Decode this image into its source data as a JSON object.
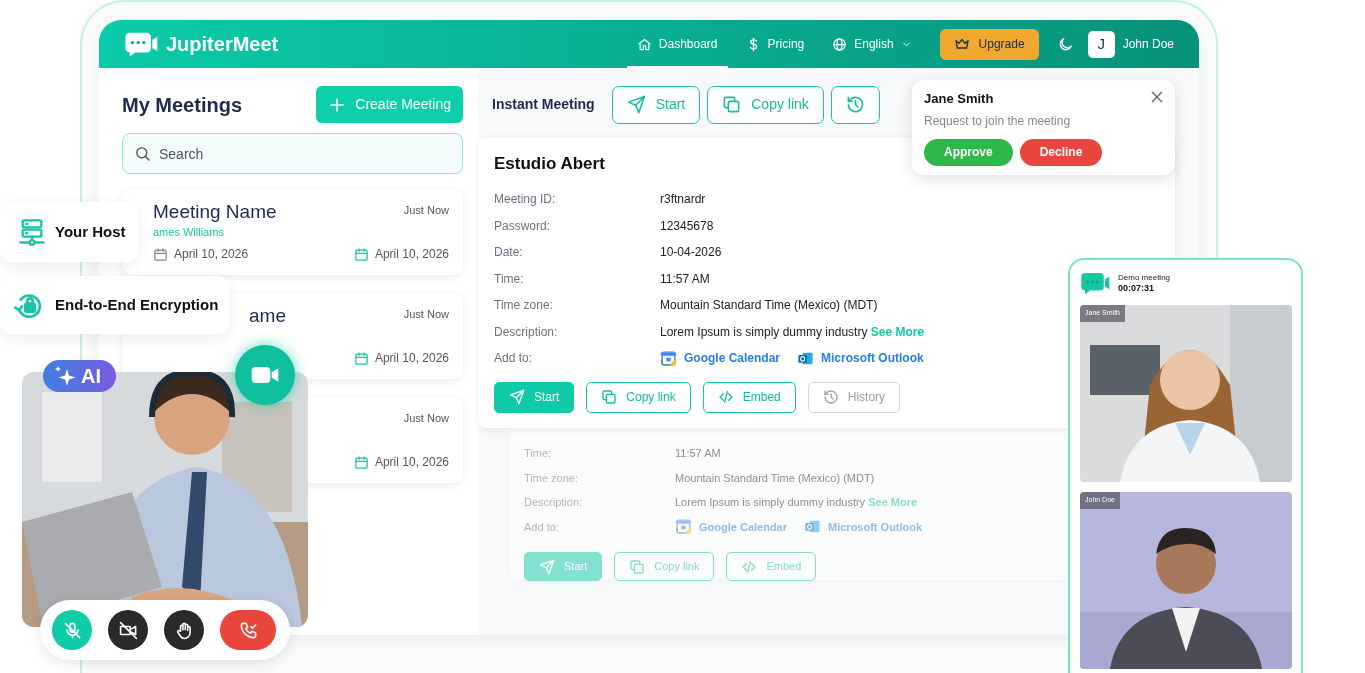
{
  "nav": {
    "brand": "JupiterMeet",
    "items": [
      {
        "label": "Dashboard",
        "selected": true,
        "dropdown": false
      },
      {
        "label": "Pricing",
        "selected": false,
        "dropdown": false
      },
      {
        "label": "English",
        "selected": false,
        "dropdown": true
      }
    ],
    "upgrade": "Upgrade",
    "user": {
      "initial": "J",
      "name": "John Doe"
    }
  },
  "meetings": {
    "title": "My Meetings",
    "create": "Create Meeting",
    "search": {
      "placeholder": "Search"
    },
    "items": [
      {
        "title": "Meeting Name",
        "time": "Just Now",
        "host": "ames Williams",
        "start_date": "April 10, 2026",
        "end_date": "April 10, 2026"
      },
      {
        "title": "ame",
        "time": "Just Now",
        "end_date": "April 10, 2026"
      },
      {
        "time": "Just Now",
        "end_date": "April 10, 2026"
      }
    ]
  },
  "instant": {
    "label": "Instant Meeting",
    "buttons": [
      {
        "kind": "start",
        "label": "Start"
      },
      {
        "kind": "copy",
        "label": "Copy link"
      },
      {
        "kind": "history"
      }
    ]
  },
  "detail": {
    "title": "Estudio Abert",
    "rows": [
      {
        "kind": "text",
        "label": "Meeting ID:",
        "value": "r3ftnardr"
      },
      {
        "kind": "text",
        "label": "Password:",
        "value": "12345678"
      },
      {
        "kind": "text",
        "label": "Date:",
        "value": "10-04-2026"
      },
      {
        "kind": "text",
        "label": "Time:",
        "value": "11:57 AM"
      },
      {
        "kind": "text",
        "label": "Time zone:",
        "value": "Mountain Standard Time (Mexico) (MDT)"
      },
      {
        "kind": "text",
        "label": "Description:",
        "value": "Lorem Ipsum is simply dummy industry",
        "link": "See More"
      },
      {
        "kind": "calendars",
        "label": "Add to:",
        "calendars": [
          {
            "kind": "google",
            "label": "Google Calendar"
          },
          {
            "kind": "outlook",
            "label": "Microsoft Outlook"
          }
        ]
      }
    ],
    "buttons": [
      {
        "label": "Start",
        "kind": "primary",
        "disabled": false
      },
      {
        "label": "Copy link",
        "kind": "outline",
        "disabled": false
      },
      {
        "label": "Embed",
        "kind": "outline",
        "disabled": false
      },
      {
        "label": "History",
        "kind": "outline",
        "disabled": true
      }
    ]
  },
  "detail_behind": {
    "rows": [
      {
        "kind": "text",
        "label": "Time:",
        "value": "11:57 AM"
      },
      {
        "kind": "text",
        "label": "Time zone:",
        "value": "Mountain Standard Time (Mexico) (MDT)"
      },
      {
        "kind": "text",
        "label": "Description:",
        "value": "Lorem Ipsum is simply dummy industry",
        "link": "See More"
      },
      {
        "kind": "calendars",
        "label": "Add to:",
        "calendars": [
          {
            "kind": "google",
            "label": "Google Calendar"
          },
          {
            "kind": "outlook",
            "label": "Microsoft Outlook"
          }
        ]
      }
    ],
    "buttons": [
      {
        "label": "Start",
        "kind": "primary",
        "disabled": false
      },
      {
        "label": "Copy link",
        "kind": "outline",
        "disabled": false
      },
      {
        "label": "Embed",
        "kind": "outline",
        "disabled": false
      }
    ]
  },
  "join_request": {
    "name": "Jane Smith",
    "message": "Request to join the meeting",
    "approve": "Approve",
    "decline": "Decline"
  },
  "call_panel": {
    "title": "Demo meeting",
    "timer": "00:07:31",
    "tiles": [
      {
        "name": "Jane Smith",
        "kind": "picture"
      },
      {
        "name": "John Doe",
        "kind": "picture"
      }
    ]
  },
  "features": [
    {
      "label": "Your Host"
    },
    {
      "label": "End-to-End Encryption"
    }
  ],
  "ai_badge": {
    "label": "AI"
  },
  "controls": [
    {
      "kind": "mic-off"
    },
    {
      "kind": "camera-off"
    },
    {
      "kind": "hand"
    },
    {
      "kind": "end-call"
    }
  ]
}
